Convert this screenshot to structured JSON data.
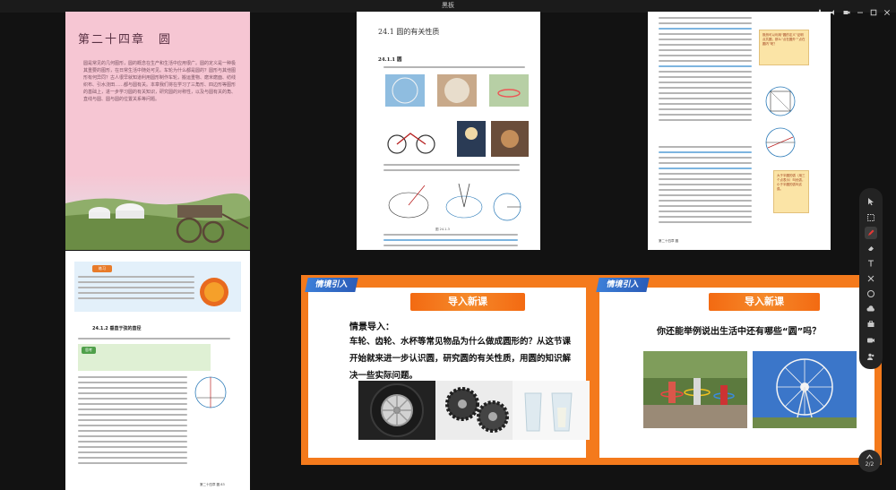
{
  "window": {
    "title": "黑板"
  },
  "page1": {
    "chapter": "第二十四章　圆",
    "intro": "圆是常见的几何图形，圆的概念在生产和生活中应用很广。圆的定义是一种极其重要的图形，在日常生活中随处可见。车轮为什么都是圆的？圆形与其他图形有何异同？古人很早就知道利用圆形制作车轮，搬运重物、磨米磨面、纺线织布、引水浇田……都与圆有关。本章我们将在学习了三角形、四边形等图形的基础上，进一步学习圆的有关知识，研究圆的对称性，以及与圆有关的角、直线与圆、圆与圆的位置关系等问题。"
  },
  "page2": {
    "section": "24.1 圆的有关性质",
    "subsection": "24.1.1 圆",
    "figcap": "图 24.1-3"
  },
  "page3": {
    "note1": "既然可以利用“圆的定义”证明点共圆，那么“点在圆外”“点在圆内”呢？",
    "note2": "大于半圆的弧（用三个点表示）叫优弧，小于半圆的弧叫劣弧。",
    "footer": "第二十四章 圆"
  },
  "page4": {
    "exercise_tag": "练习",
    "subsection": "24.1.2 垂直于弦的直径",
    "thinking_tag": "思考",
    "footer": "第二十四章 圆 83"
  },
  "slide1": {
    "tag": "情境引入",
    "banner": "导入新课",
    "heading": "情景导入：",
    "body": "车轮、齿轮、水杯等常见物品为什么做成圆形的？从这节课开始就来进一步认识圆，研究圆的有关性质，用圆的知识解决一些实际问题。"
  },
  "slide2": {
    "tag": "情境引入",
    "banner": "导入新课",
    "question": "你还能举例说出生活中还有哪些“圆”吗？"
  },
  "page_indicator": {
    "current": "2",
    "total": "2"
  }
}
